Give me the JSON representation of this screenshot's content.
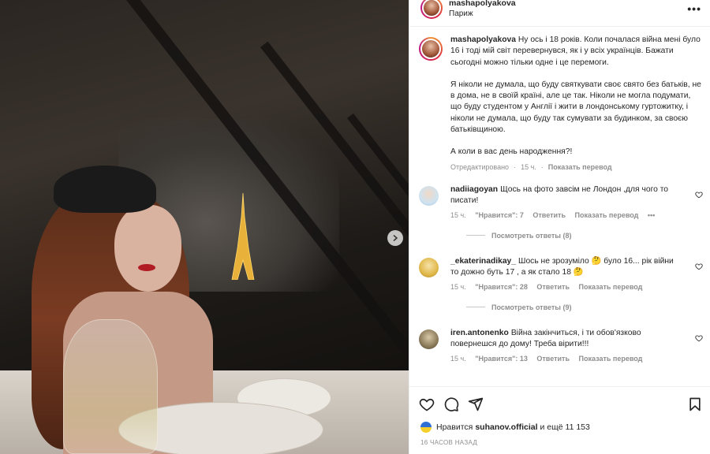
{
  "post": {
    "username": "mashapolyakova",
    "location": "Париж",
    "more_label": "•••"
  },
  "caption": {
    "username": "mashapolyakova",
    "paragraphs": [
      "Ну ось і 18 років. Коли почалася війна мені було 16 і тоді мій світ перевернувся, як і у всіх українців. Бажати сьогодні можно тільки одне і це перемоги.",
      "Я ніколи не думала, що буду святкувати своє свято без батьків, не в дома, не в своїй країні, але це так. Ніколи не могла подумати, що буду студентом у Англії і жити в лондонському гуртожитку, і ніколи не думала, що буду так сумувати за будинком, за своєю батьківщиною.",
      "А коли в вас день народження?!"
    ],
    "edited": "Отредактировано",
    "time": "15 ч.",
    "translate": "Показать перевод"
  },
  "comments": [
    {
      "username": "nadiiagoyan",
      "text": "Щось на фото завсім не Лондон ,для чого то писати!",
      "time": "15 ч.",
      "likes": "\"Нравится\": 7",
      "reply": "Ответить",
      "translate": "Показать перевод",
      "more": "•••",
      "replies": "Посмотреть ответы (8)",
      "avatar_color": "#cfe3f0"
    },
    {
      "username": "_ekaterinadikay_",
      "text": "Шось не зрозуміло 🤔 було 16... рік війни то дожно буть 17 , а як стало 18 🤔",
      "time": "15 ч.",
      "likes": "\"Нравится\": 28",
      "reply": "Ответить",
      "translate": "Показать перевод",
      "replies": "Посмотреть ответы (9)",
      "avatar_color": "#e0b84a"
    },
    {
      "username": "iren.antonenko",
      "text": "Війна закінчиться, і ти обов'язково повернешся до дому! Треба вірити!!!",
      "time": "15 ч.",
      "likes": "\"Нравится\": 13",
      "reply": "Ответить",
      "translate": "Показать перевод",
      "avatar_color": "#8a7a5a"
    }
  ],
  "footer": {
    "liked_prefix": "Нравится",
    "liked_user": "suhanov.official",
    "liked_suffix": "и ещё 11 153",
    "timestamp": "16 ЧАСОВ НАЗАД"
  },
  "icons": [
    "heart-icon",
    "comment-icon",
    "share-icon",
    "bookmark-icon",
    "more-icon",
    "chevron-right-icon"
  ]
}
